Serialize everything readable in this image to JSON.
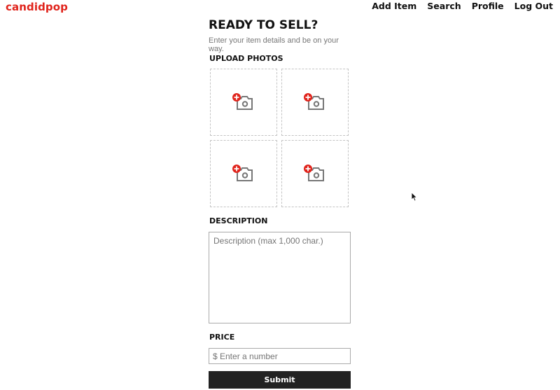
{
  "brand": {
    "name": "candidpop",
    "color": "#e0231b"
  },
  "nav": {
    "items": [
      {
        "label": "Add Item"
      },
      {
        "label": "Search"
      },
      {
        "label": "Profile"
      },
      {
        "label": "Log Out"
      }
    ]
  },
  "page": {
    "title": "READY TO SELL?",
    "subtitle": "Enter your item details and be on your way."
  },
  "photos": {
    "label": "UPLOAD PHOTOS",
    "slots": [
      {
        "icon": "add-photo-icon"
      },
      {
        "icon": "add-photo-icon"
      },
      {
        "icon": "add-photo-icon"
      },
      {
        "icon": "add-photo-icon"
      }
    ],
    "accent": "#e0231b"
  },
  "description": {
    "label": "DESCRIPTION",
    "placeholder": "Description (max 1,000 char.)",
    "value": ""
  },
  "price": {
    "label": "PRICE",
    "placeholder": "$ Enter a number",
    "value": ""
  },
  "submit": {
    "label": "Submit",
    "color": "#222222"
  }
}
